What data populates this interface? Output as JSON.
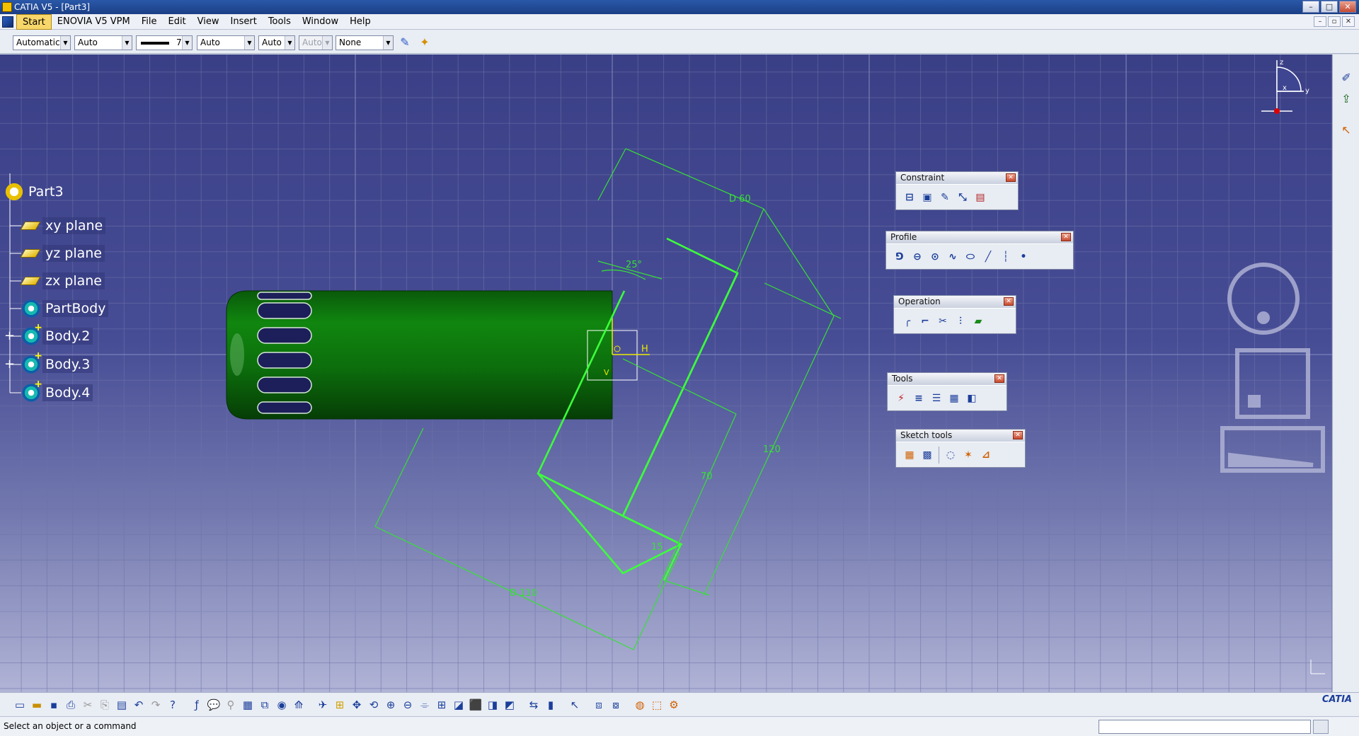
{
  "window": {
    "title": "CATIA V5 - [Part3]"
  },
  "menu": [
    "Start",
    "ENOVIA V5 VPM",
    "File",
    "Edit",
    "View",
    "Insert",
    "Tools",
    "Window",
    "Help"
  ],
  "properties_bar": {
    "color": "Automatic",
    "transparency": "Auto",
    "line_thickness": "7",
    "line_type": "Auto",
    "point_type": "Auto",
    "layer_auto": "Auto",
    "layer": "None"
  },
  "tree": {
    "root": "Part3",
    "items": [
      "xy plane",
      "yz plane",
      "zx plane",
      "PartBody",
      "Body.2",
      "Body.3",
      "Body.4"
    ]
  },
  "dimensions": {
    "d60": "D 60",
    "angle": "25°",
    "h": "H",
    "v": "V",
    "d70": "70",
    "d120": "120",
    "d15": "15",
    "d110": "D 110"
  },
  "compass_axes": {
    "x": "x",
    "y": "y",
    "z": "z"
  },
  "toolbars": {
    "constraint": "Constraint",
    "profile": "Profile",
    "operation": "Operation",
    "tools": "Tools",
    "sketch_tools": "Sketch tools"
  },
  "brand": "CATIA",
  "status": {
    "message": "Select an object or a command"
  },
  "colors": {
    "background_top": "#3a3f86",
    "model_green": "#0f7a0f",
    "sketch_green": "#36ff36"
  }
}
